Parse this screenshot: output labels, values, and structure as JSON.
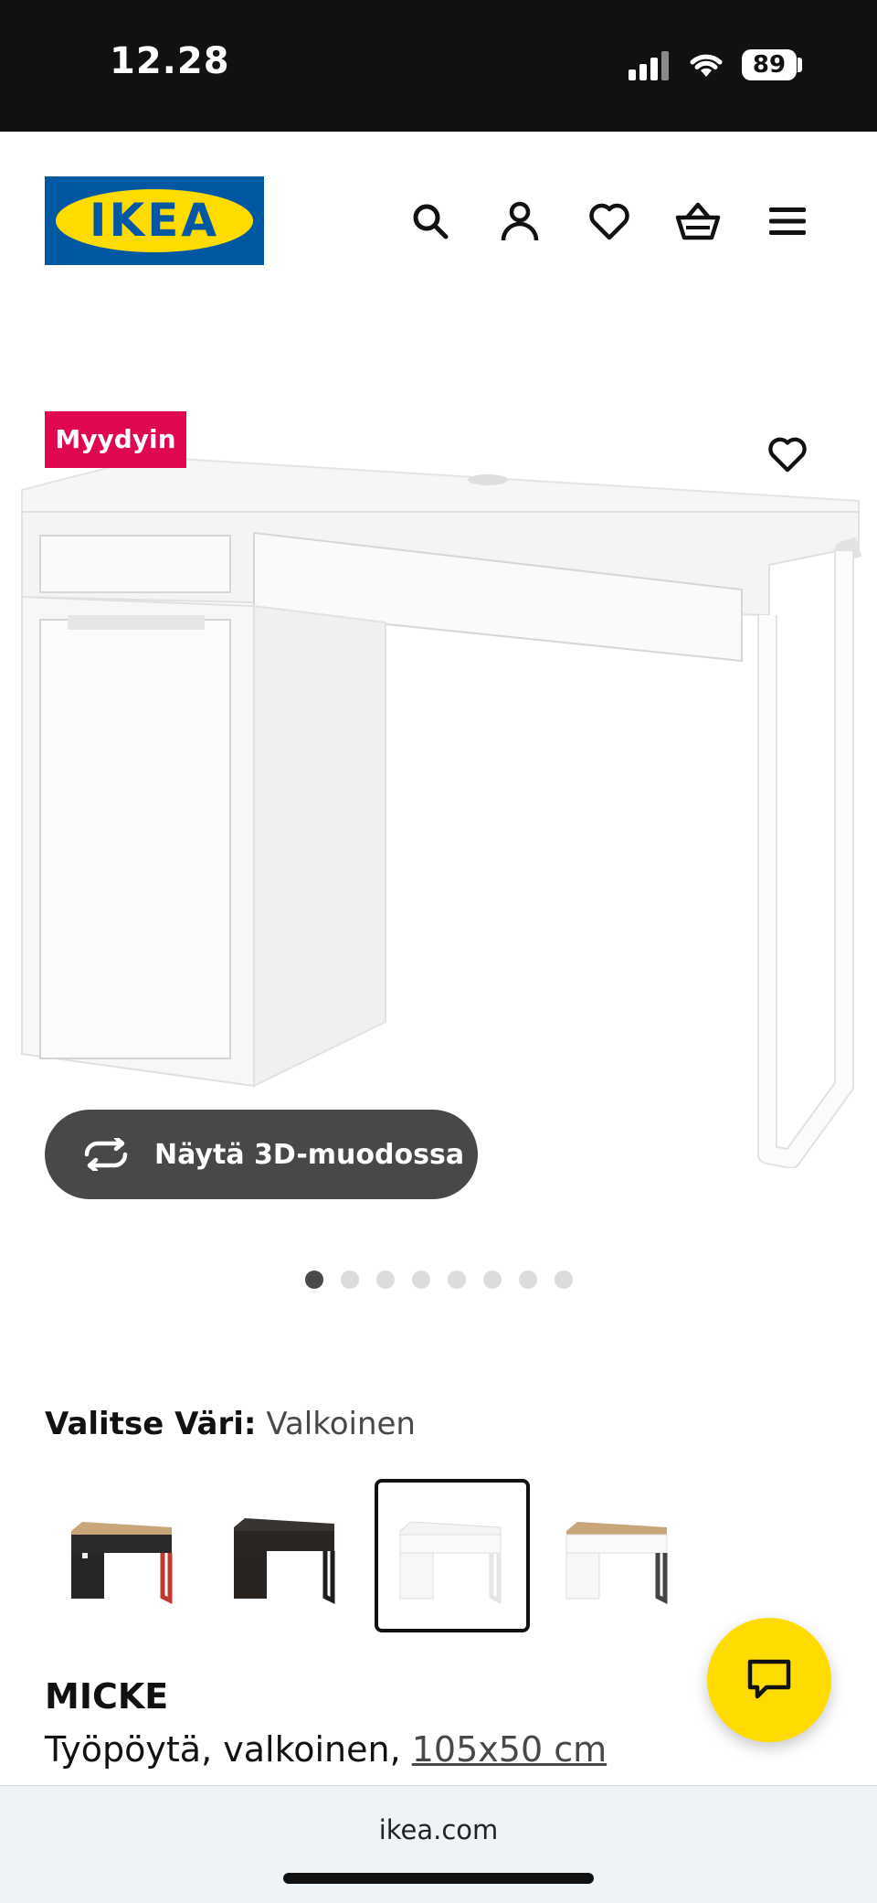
{
  "status_bar": {
    "time": "12.28",
    "battery": "89"
  },
  "header": {
    "logo_text": "IKEA"
  },
  "gallery": {
    "badge": "Myydyin",
    "view_3d_label": "Näytä 3D-muodossa",
    "image_count": 8,
    "active_index": 1
  },
  "color_selector": {
    "label": "Valitse Väri:",
    "selected": "Valkoinen"
  },
  "product": {
    "name": "MICKE",
    "description": "Työpöytä, valkoinen,",
    "dimensions": "105x50 cm"
  },
  "browser": {
    "url": "ikea.com"
  },
  "colors": {
    "ikea_blue": "#0058a3",
    "ikea_yellow": "#ffdb00",
    "badge_red": "#e00751",
    "button_dark": "#484848"
  }
}
